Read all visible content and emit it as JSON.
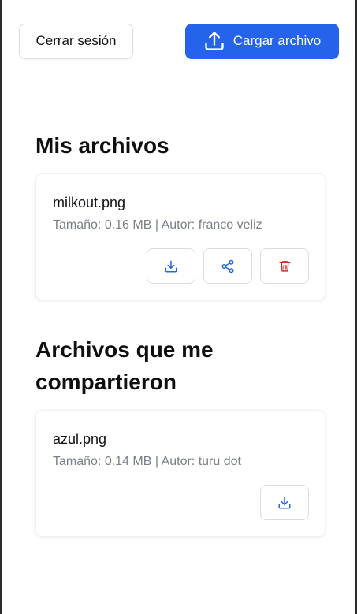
{
  "header": {
    "logout_label": "Cerrar sesión",
    "upload_label": "Cargar archivo"
  },
  "my_files": {
    "title": "Mis archivos",
    "items": [
      {
        "name": "milkout.png",
        "meta": "Tamaño: 0.16 MB | Autor: franco veliz"
      }
    ]
  },
  "shared_files": {
    "title": "Archivos que me compartieron",
    "items": [
      {
        "name": "azul.png",
        "meta": "Tamaño: 0.14 MB | Autor: turu dot"
      }
    ]
  },
  "colors": {
    "accent": "#2563eb",
    "danger": "#dc2626",
    "muted_text": "#7a7f87"
  },
  "icons": {
    "upload": "upload-icon",
    "download": "download-icon",
    "share": "share-icon",
    "delete": "trash-icon"
  }
}
